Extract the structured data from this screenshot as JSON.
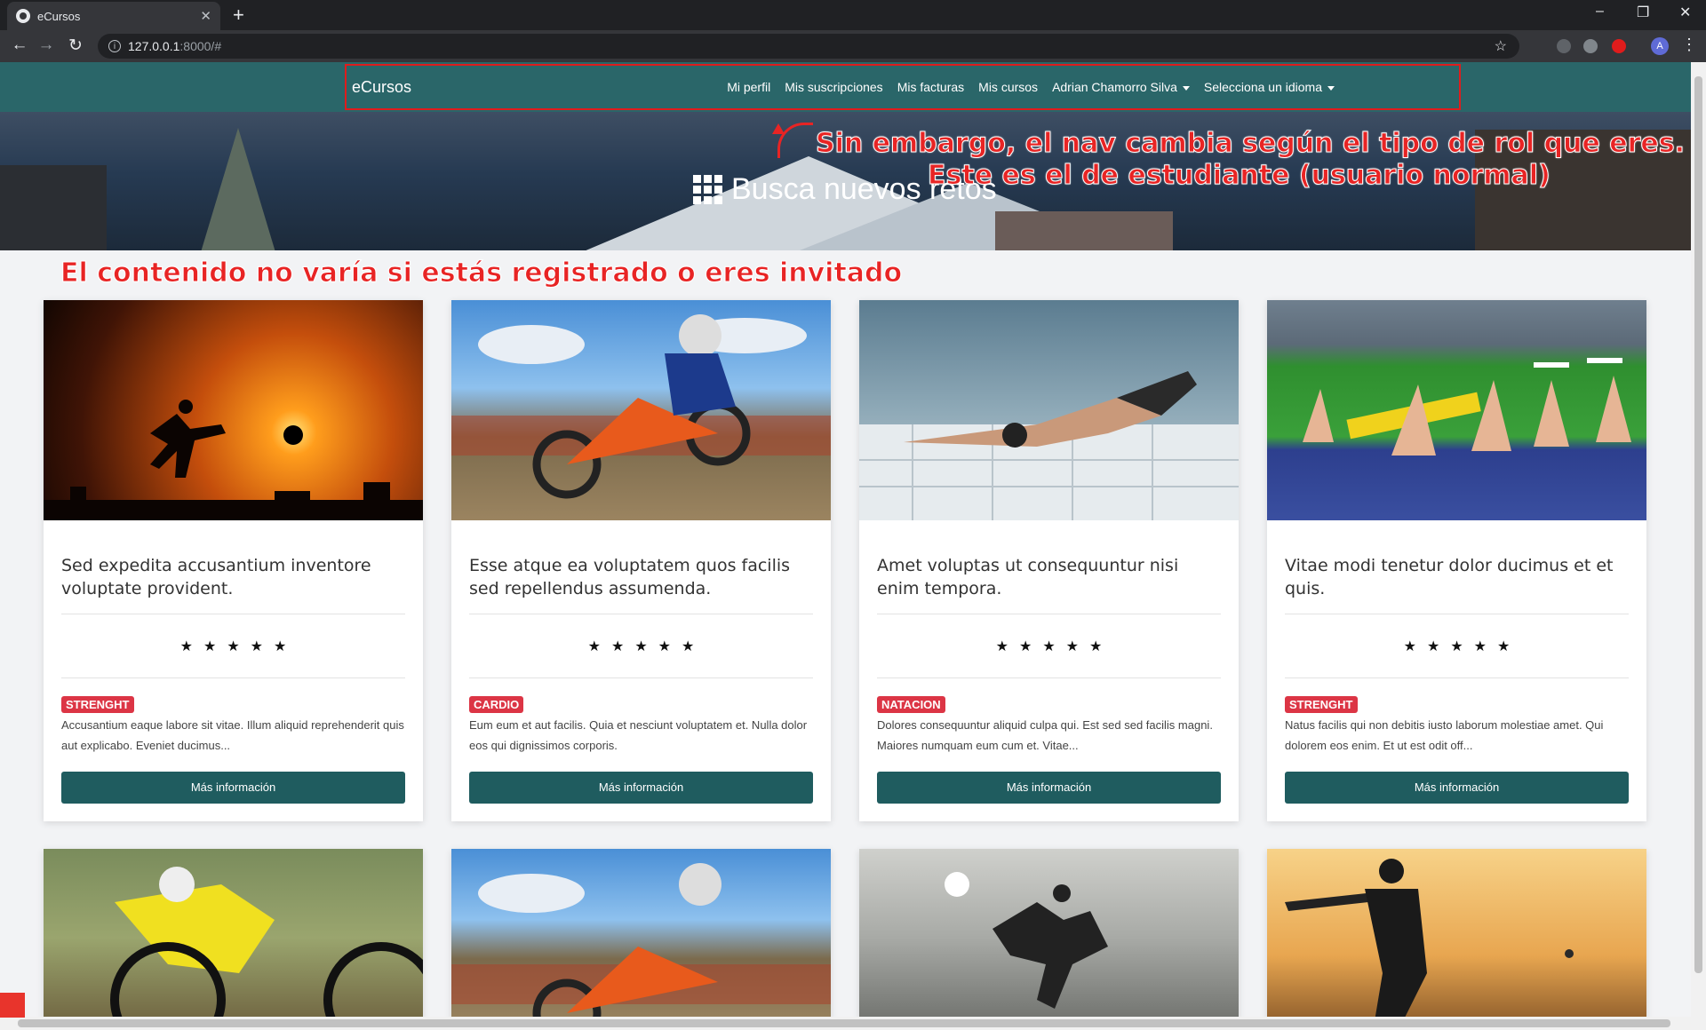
{
  "browser": {
    "tab_title": "eCursos",
    "url_host": "127.0.0.1",
    "url_path": ":8000/#",
    "profile_initial": "A"
  },
  "nav": {
    "brand": "eCursos",
    "links": [
      "Mi perfil",
      "Mis suscripciones",
      "Mis facturas",
      "Mis cursos"
    ],
    "user_menu": "Adrian Chamorro Silva",
    "language_menu": "Selecciona un idioma"
  },
  "hero": {
    "title": "Busca nuevos retos"
  },
  "annotations": {
    "nav_line1": "Sin embargo, el nav cambia según el tipo de rol que eres.",
    "nav_line2": "Este es el de estudiante (usuario normal)",
    "content": "El contenido no varía si estás registrado o eres invitado"
  },
  "courses": [
    {
      "title": "Sed expedita accusantium inventore voluptate provident.",
      "rating": 5,
      "category": "STRENGHT",
      "description": "Accusantium eaque labore sit vitae. Illum aliquid reprehenderit quis aut explicabo. Eveniet ducimus...",
      "button": "Más información"
    },
    {
      "title": "Esse atque ea voluptatem quos facilis sed repellendus assumenda.",
      "rating": 5,
      "category": "CARDIO",
      "description": "Eum eum et aut facilis. Quia et nesciunt voluptatem et. Nulla dolor eos qui dignissimos corporis.",
      "button": "Más información"
    },
    {
      "title": "Amet voluptas ut consequuntur nisi enim tempora.",
      "rating": 5,
      "category": "NATACION",
      "description": "Dolores consequuntur aliquid culpa qui. Est sed sed facilis magni. Maiores numquam eum cum et. Vitae...",
      "button": "Más información"
    },
    {
      "title": "Vitae modi tenetur dolor ducimus et et quis.",
      "rating": 5,
      "category": "STRENGHT",
      "description": "Natus facilis qui non debitis iusto laborum molestiae amet. Qui dolorem eos enim. Et ut est odit off...",
      "button": "Más información"
    }
  ],
  "colors": {
    "nav_bg": "#2a6669",
    "button_bg": "#1f5c5f",
    "badge_bg": "#dc3545",
    "annotation": "#e82424"
  }
}
